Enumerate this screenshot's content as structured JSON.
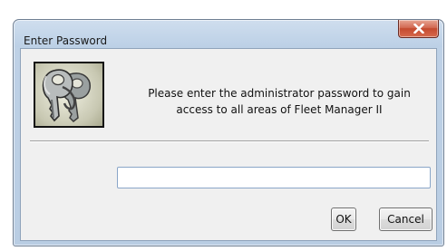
{
  "window": {
    "title": "Enter Password"
  },
  "icons": {
    "close": "close-icon",
    "keys": "keys-icon"
  },
  "message": {
    "line1": "Please enter the administrator password to gain",
    "line2": "access to all areas of Fleet Manager II"
  },
  "password": {
    "value": "",
    "placeholder": ""
  },
  "buttons": {
    "ok": "OK",
    "cancel": "Cancel"
  },
  "colors": {
    "frame": "#bcd0e6",
    "close_button": "#c44a2f",
    "client_background": "#f0f0f0"
  }
}
